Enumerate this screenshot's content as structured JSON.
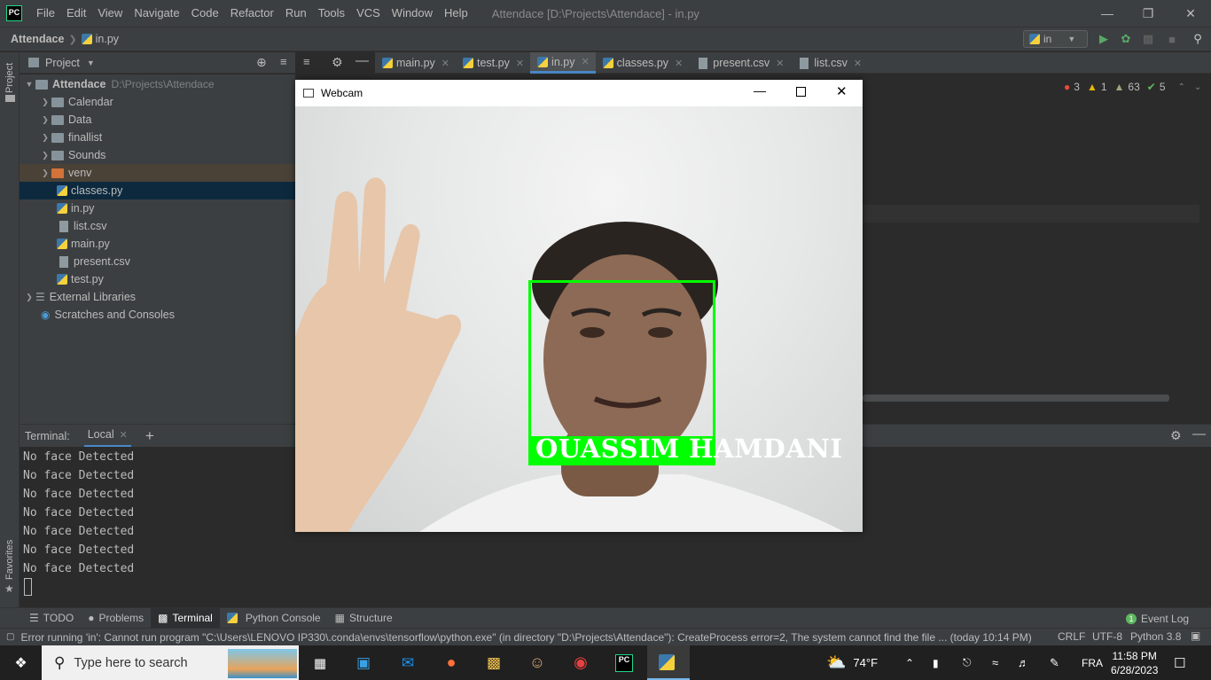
{
  "app": {
    "logo": "PC",
    "menu": [
      "File",
      "Edit",
      "View",
      "Navigate",
      "Code",
      "Refactor",
      "Run",
      "Tools",
      "VCS",
      "Window",
      "Help"
    ],
    "window_title": "Attendace [D:\\Projects\\Attendace] - in.py"
  },
  "navbar": {
    "project": "Attendace",
    "file": "in.py",
    "run_config": "in"
  },
  "project_panel": {
    "title": "Project",
    "side_label": "Project",
    "tree": [
      {
        "label": "Attendace",
        "hint": "D:\\Projects\\Attendace",
        "type": "root"
      },
      {
        "label": "Calendar",
        "type": "folder"
      },
      {
        "label": "Data",
        "type": "folder"
      },
      {
        "label": "finallist",
        "type": "folder"
      },
      {
        "label": "Sounds",
        "type": "folder"
      },
      {
        "label": "venv",
        "type": "folder-excluded"
      },
      {
        "label": "classes.py",
        "type": "py",
        "selected": true
      },
      {
        "label": "in.py",
        "type": "py"
      },
      {
        "label": "list.csv",
        "type": "csv"
      },
      {
        "label": "main.py",
        "type": "py"
      },
      {
        "label": "present.csv",
        "type": "csv"
      },
      {
        "label": "test.py",
        "type": "py"
      },
      {
        "label": "External Libraries",
        "type": "lib"
      },
      {
        "label": "Scratches and Consoles",
        "type": "scratch"
      }
    ]
  },
  "editor_tabs": [
    {
      "label": "main.py",
      "active": false
    },
    {
      "label": "test.py",
      "active": false
    },
    {
      "label": "in.py",
      "active": true
    },
    {
      "label": "classes.py",
      "active": false
    },
    {
      "label": "present.csv",
      "active": false
    },
    {
      "label": "list.csv",
      "active": false
    }
  ],
  "inspection": {
    "errors": "3",
    "warnings": "1",
    "weak": "63",
    "ok": "5"
  },
  "webcam": {
    "title": "Webcam",
    "detected_name": "OUASSIM  HAMDANI"
  },
  "terminal": {
    "label": "Terminal:",
    "tab": "Local",
    "lines": [
      "No face Detected",
      "No face Detected",
      "No face Detected",
      "No face Detected",
      "No face Detected",
      "No face Detected",
      "No face Detected"
    ],
    "favorites_label": "Favorites"
  },
  "bottom_tools": [
    {
      "label": "TODO",
      "active": false
    },
    {
      "label": "Problems",
      "active": false
    },
    {
      "label": "Terminal",
      "active": true
    },
    {
      "label": "Python Console",
      "active": false
    },
    {
      "label": "Structure",
      "active": false
    }
  ],
  "event_log": {
    "count": "1",
    "label": "Event Log"
  },
  "status": {
    "message": "Error running 'in': Cannot run program \"C:\\Users\\LENOVO IP330\\.conda\\envs\\tensorflow\\python.exe\" (in directory \"D:\\Projects\\Attendace\"): CreateProcess error=2, The system cannot find the file ... (today 10:14 PM)",
    "line_sep": "CRLF",
    "encoding": "UTF-8",
    "interpreter": "Python 3.8"
  },
  "taskbar": {
    "search_placeholder": "Type here to search",
    "weather": "74°F",
    "language": "FRA",
    "time": "11:58 PM",
    "date": "6/28/2023"
  },
  "colors": {
    "accent": "#4a88c7",
    "face_box": "#00ff00",
    "ide_bg": "#3c3f41",
    "editor_bg": "#2b2b2b"
  }
}
